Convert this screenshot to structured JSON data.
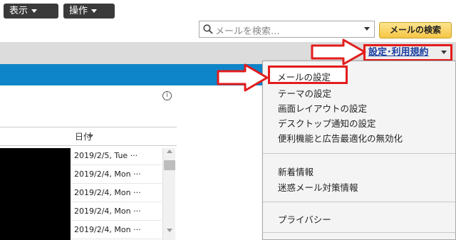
{
  "search": {
    "placeholder": "メールを検索...",
    "button_label": "メールの検索"
  },
  "toolbar": {
    "view_label": "表示",
    "actions_label": "操作",
    "settings_label": "設定･利用規約"
  },
  "list": {
    "date_header": "日付",
    "rows": [
      "2019/2/5, Tue ···",
      "2019/2/4, Mon ···",
      "2019/2/4, Mon ···",
      "2019/2/4, Mon ···",
      "2019/2/4, Mon ···"
    ]
  },
  "menu": {
    "group1": [
      "メールの設定",
      "テーマの設定",
      "画面レイアウトの設定",
      "デスクトップ通知の設定",
      "便利機能と広告最適化の無効化"
    ],
    "group2": [
      "新着情報",
      "迷惑メール対策情報"
    ],
    "group3": [
      "プライバシー"
    ]
  },
  "colors": {
    "accent_blue": "#0f85c9",
    "highlight_red": "#e41c1c",
    "search_button": "#f6c645",
    "link_blue": "#1a3fa0"
  },
  "icons": [
    "search-icon",
    "dropdown-caret-icon",
    "info-icon",
    "arrow-pointer-icon"
  ]
}
